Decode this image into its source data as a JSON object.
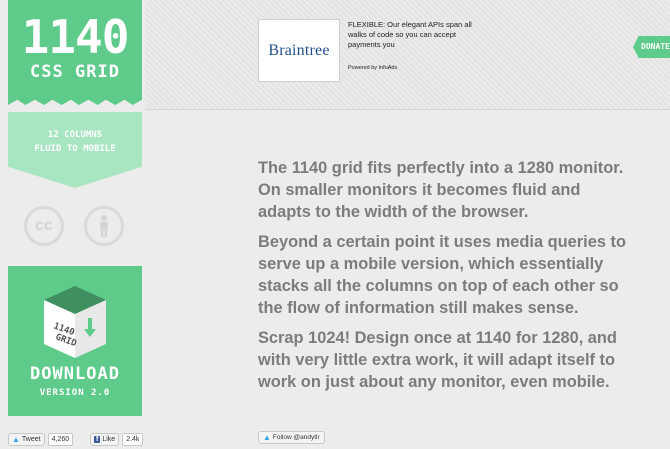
{
  "logo": {
    "title": "1140",
    "subtitle": "CSS GRID"
  },
  "tagline": {
    "line1": "12 COLUMNS",
    "line2": "FLUID TO MOBILE"
  },
  "license_icons": {
    "cc_label": "cc"
  },
  "download": {
    "box_line1": "1140",
    "box_line2": "GRID",
    "title": "DOWNLOAD",
    "version": "VERSION 2.0"
  },
  "social": {
    "tweet_label": "Tweet",
    "tweet_count": "4,260",
    "like_label": "Like",
    "like_count": "2.4k",
    "fb_glyph": "f"
  },
  "ad": {
    "brand": "Braintree",
    "headline": "FLEXIBLE: Our elegant APIs span all walks of code so you can accept payments you",
    "powered_by": "Powered by InfuAds"
  },
  "donate": {
    "label": "DONATE"
  },
  "main": {
    "paragraphs": [
      [
        "The 1140 grid fits perfectly into a 1280 monitor.",
        "On smaller monitors it becomes fluid and",
        "adapts to the width of the browser."
      ],
      [
        "Beyond a certain point it uses media queries to",
        "serve up a mobile version, which essentially",
        "stacks all the columns on top of each other so",
        "the flow of information still makes sense."
      ],
      [
        "Scrap 1024! Design once at 1140 for 1280, and",
        "with very little extra work, it will adapt itself to",
        "work on just about any monitor, even mobile."
      ]
    ]
  },
  "follow": {
    "label": "Follow @andytlr"
  },
  "colors": {
    "accent": "#5fcb8a",
    "accent_light": "#a8e6c2",
    "text": "#7c7c7c"
  },
  "icons": {
    "cc": "creative-commons-icon",
    "person": "attribution-person-icon",
    "box": "download-box-icon",
    "bird": "twitter-bird-icon"
  }
}
